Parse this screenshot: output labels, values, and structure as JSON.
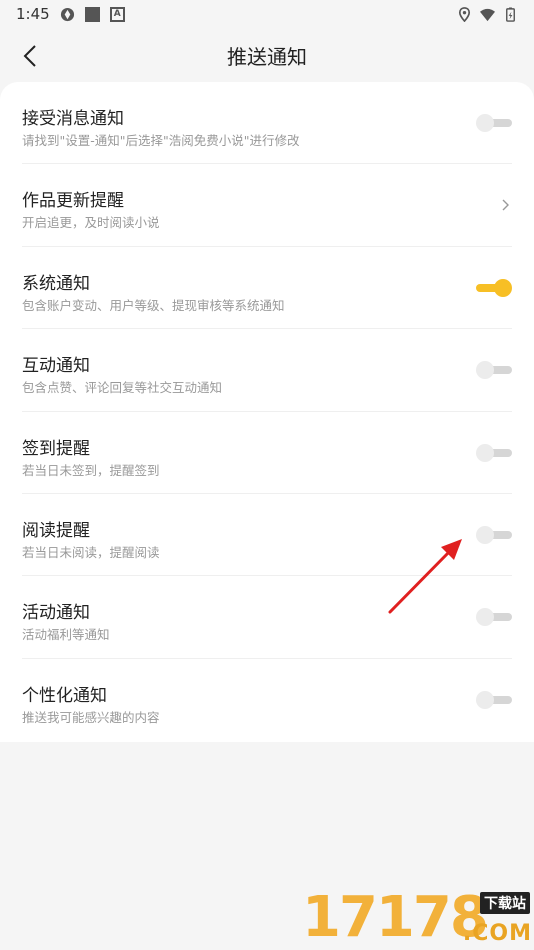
{
  "status_bar": {
    "time": "1:45",
    "left_icons": [
      "aperture-icon",
      "square-icon",
      "a-box-icon"
    ],
    "right_icons": [
      "location-icon",
      "wifi-icon",
      "battery-icon"
    ]
  },
  "header": {
    "title": "推送通知",
    "back_icon": "chevron-left-icon"
  },
  "colors": {
    "toggle_on": "#f7bf25",
    "toggle_off_track": "#d6d6d6",
    "annotation_arrow": "#e02020"
  },
  "settings": [
    {
      "title": "接受消息通知",
      "desc": "请找到\"设置-通知\"后选择\"浩阅免费小说\"进行修改",
      "control": "toggle",
      "on": false
    },
    {
      "title": "作品更新提醒",
      "desc": "开启追更，及时阅读小说",
      "control": "chevron",
      "on": null
    },
    {
      "title": "系统通知",
      "desc": "包含账户变动、用户等级、提现审核等系统通知",
      "control": "toggle",
      "on": true
    },
    {
      "title": "互动通知",
      "desc": "包含点赞、评论回复等社交互动通知",
      "control": "toggle",
      "on": false
    },
    {
      "title": "签到提醒",
      "desc": "若当日未签到，提醒签到",
      "control": "toggle",
      "on": false
    },
    {
      "title": "阅读提醒",
      "desc": "若当日未阅读，提醒阅读",
      "control": "toggle",
      "on": false
    },
    {
      "title": "活动通知",
      "desc": "活动福利等通知",
      "control": "toggle",
      "on": false
    },
    {
      "title": "个性化通知",
      "desc": "推送我可能感兴趣的内容",
      "control": "toggle",
      "on": false
    }
  ],
  "watermark": {
    "number": "17178",
    "tag": "下载站",
    "domain": ".COM"
  }
}
